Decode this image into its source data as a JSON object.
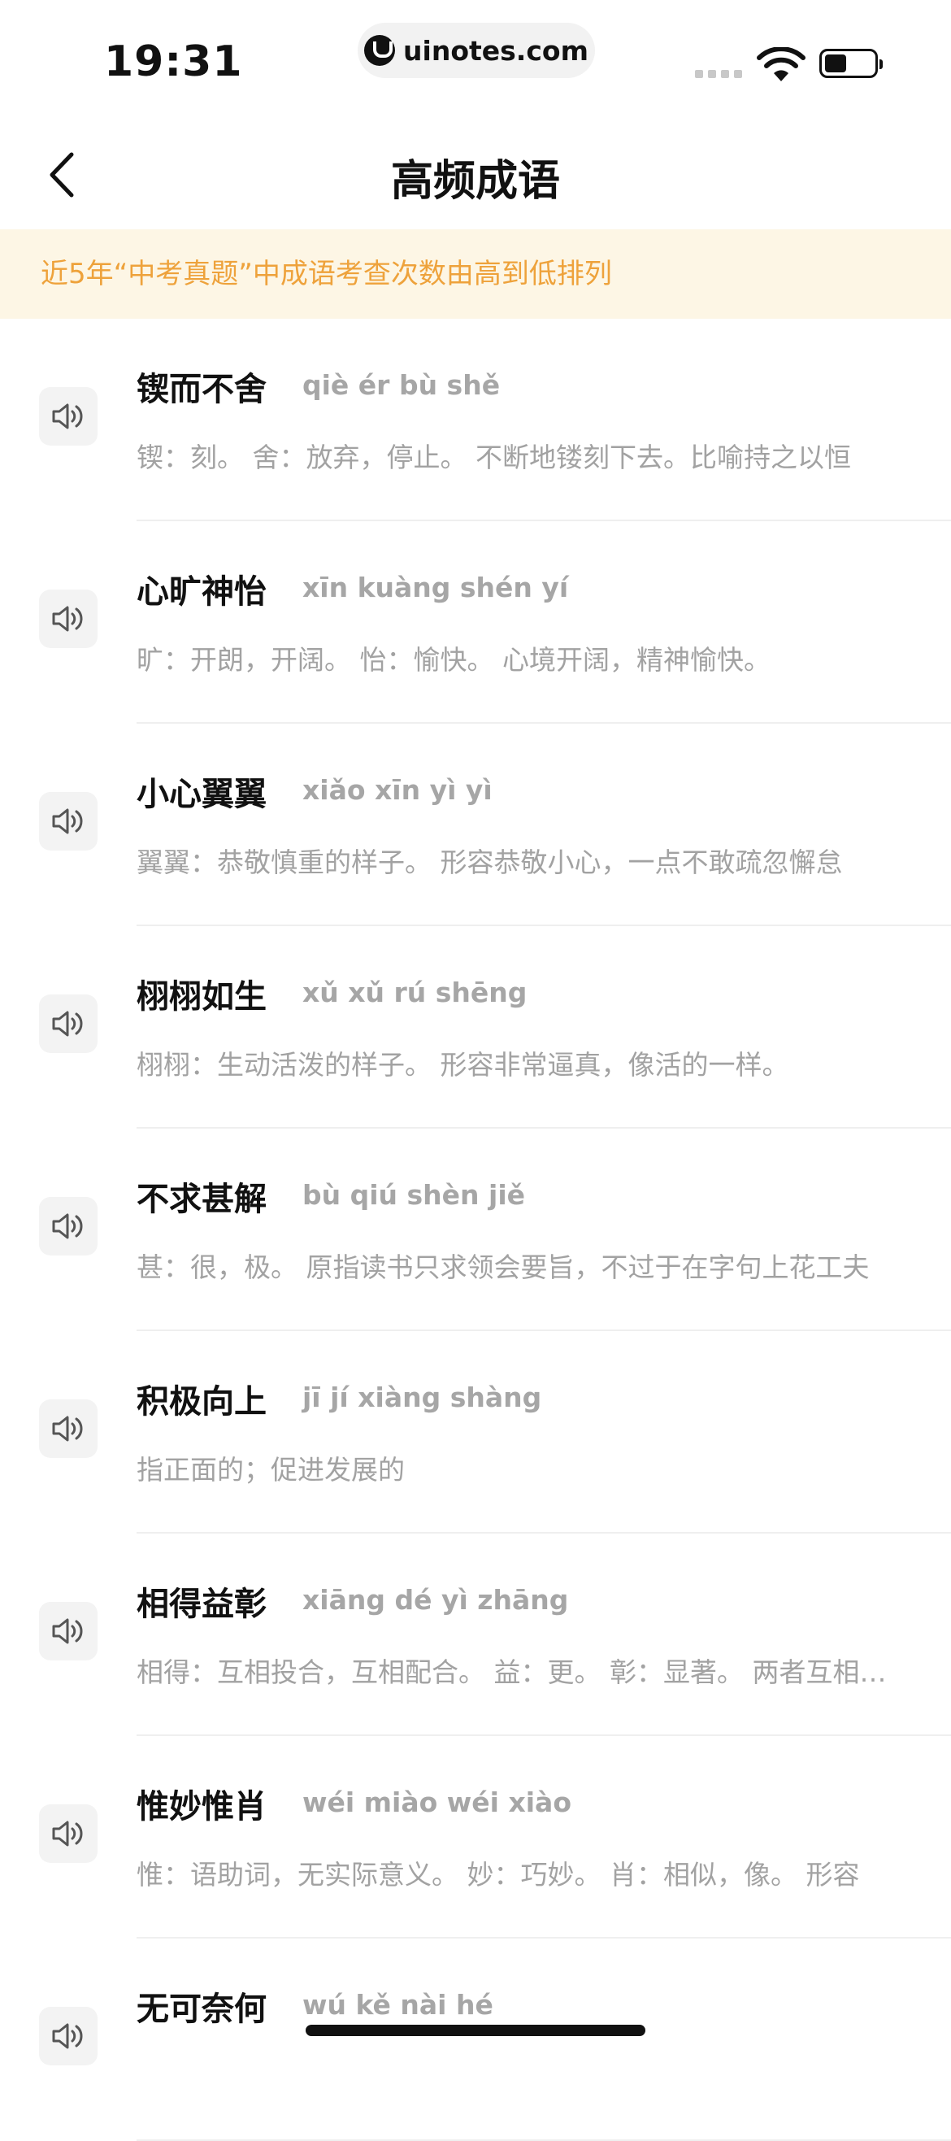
{
  "status_bar": {
    "time": "19:31",
    "url": "uinotes.com"
  },
  "nav": {
    "title": "高频成语"
  },
  "notice": "近5年“中考真题”中成语考查次数由高到低排列",
  "idioms": [
    {
      "name": "锲而不舍",
      "pinyin": "qiè ér bù shě",
      "definition": "锲：刻。 舍：放弃，停止。 不断地镂刻下去。比喻持之以恒"
    },
    {
      "name": "心旷神怡",
      "pinyin": "xīn kuàng shén yí",
      "definition": "旷：开朗，开阔。 怡：愉快。 心境开阔，精神愉快。"
    },
    {
      "name": "小心翼翼",
      "pinyin": "xiǎo xīn yì yì",
      "definition": "翼翼：恭敬慎重的样子。 形容恭敬小心，一点不敢疏忽懈怠"
    },
    {
      "name": "栩栩如生",
      "pinyin": "xǔ xǔ rú shēng",
      "definition": "栩栩：生动活泼的样子。 形容非常逼真，像活的一样。"
    },
    {
      "name": "不求甚解",
      "pinyin": "bù qiú shèn jiě",
      "definition": "甚：很，极。 原指读书只求领会要旨，不过于在字句上花工夫"
    },
    {
      "name": "积极向上",
      "pinyin": "jī jí xiàng shàng",
      "definition": "指正面的；促进发展的"
    },
    {
      "name": "相得益彰",
      "pinyin": "xiāng dé yì zhāng",
      "definition": "相得：互相投合，互相配合。 益：更。 彰：显著。 两者互相配合"
    },
    {
      "name": "惟妙惟肖",
      "pinyin": "wéi miào wéi xiào",
      "definition": "惟：语助词，无实际意义。 妙：巧妙。 肖：相似，像。 形容"
    },
    {
      "name": "无可奈何",
      "pinyin": "wú kě nài hé",
      "definition": ""
    }
  ]
}
